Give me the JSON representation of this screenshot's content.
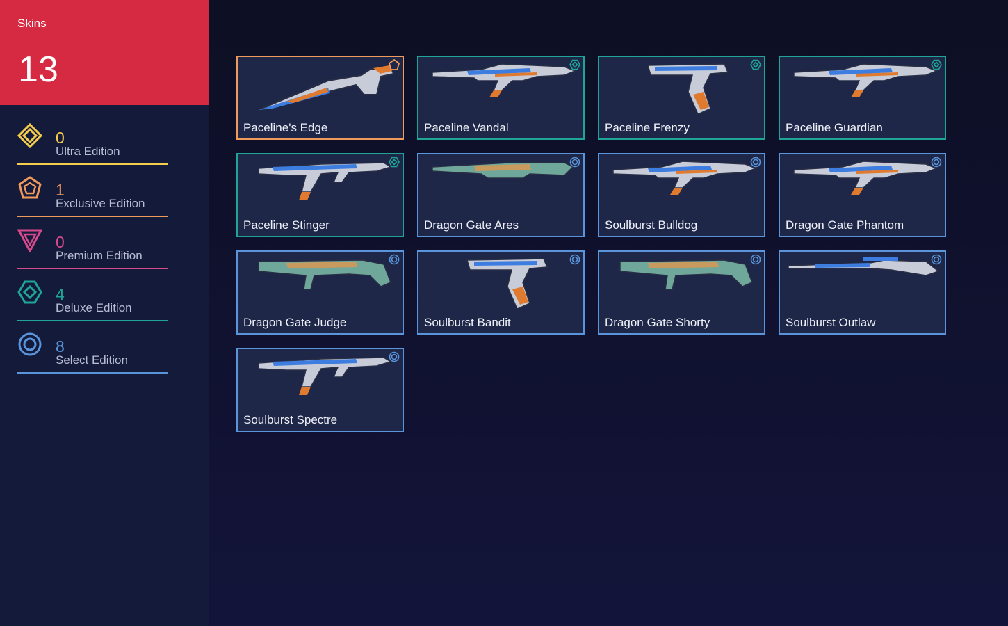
{
  "header": {
    "title": "Skins",
    "count": "13"
  },
  "tiers": [
    {
      "count": "0",
      "name": "Ultra Edition",
      "color": "#f6cc4d",
      "icon": "ultra-edition-icon"
    },
    {
      "count": "1",
      "name": "Exclusive Edition",
      "color": "#f09a5b",
      "icon": "exclusive-edition-icon"
    },
    {
      "count": "0",
      "name": "Premium Edition",
      "color": "#d6498b",
      "icon": "premium-edition-icon"
    },
    {
      "count": "4",
      "name": "Deluxe Edition",
      "color": "#1ea595",
      "icon": "deluxe-edition-icon"
    },
    {
      "count": "8",
      "name": "Select Edition",
      "color": "#5a95dc",
      "icon": "select-edition-icon"
    }
  ],
  "skins": [
    {
      "name": "Paceline's Edge",
      "tier": "exclusive",
      "art": "knife"
    },
    {
      "name": "Paceline Vandal",
      "tier": "deluxe",
      "art": "rifle"
    },
    {
      "name": "Paceline Frenzy",
      "tier": "deluxe",
      "art": "pistol"
    },
    {
      "name": "Paceline Guardian",
      "tier": "deluxe",
      "art": "rifle"
    },
    {
      "name": "Paceline Stinger",
      "tier": "deluxe",
      "art": "smg"
    },
    {
      "name": "Dragon Gate Ares",
      "tier": "select",
      "art": "lmg"
    },
    {
      "name": "Soulburst Bulldog",
      "tier": "select",
      "art": "rifle"
    },
    {
      "name": "Dragon Gate Phantom",
      "tier": "select",
      "art": "rifle"
    },
    {
      "name": "Dragon Gate Judge",
      "tier": "select",
      "art": "shotgun"
    },
    {
      "name": "Soulburst Bandit",
      "tier": "select",
      "art": "pistol"
    },
    {
      "name": "Dragon Gate Shorty",
      "tier": "select",
      "art": "shotgun"
    },
    {
      "name": "Soulburst Outlaw",
      "tier": "select",
      "art": "sniper"
    },
    {
      "name": "Soulburst Spectre",
      "tier": "select",
      "art": "smg"
    }
  ],
  "tier_colors": {
    "exclusive": "#f09a5b",
    "deluxe": "#1ea595",
    "select": "#5a95dc"
  }
}
